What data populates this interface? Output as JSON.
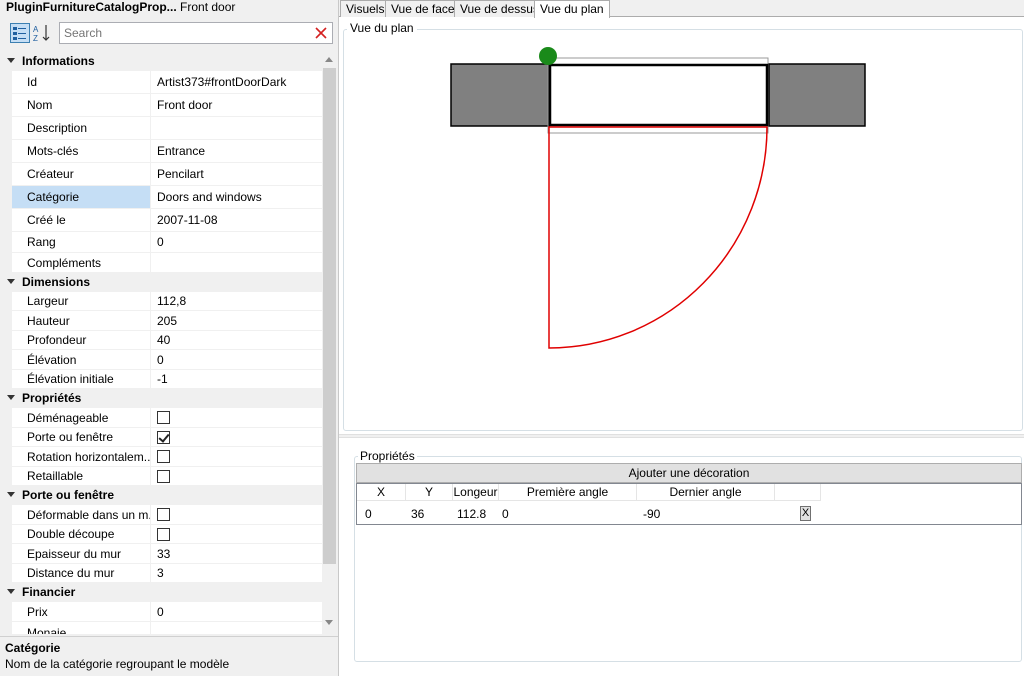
{
  "window": {
    "title_bold": "PluginFurnitureCatalogProp...",
    "title_rest": "Front door"
  },
  "toolbar": {
    "search_placeholder": "Search"
  },
  "categories": {
    "informations": "Informations",
    "dimensions": "Dimensions",
    "proprietes": "Propriétés",
    "porte": "Porte ou fenêtre",
    "financier": "Financier"
  },
  "props": {
    "id": {
      "label": "Id",
      "value": "Artist373#frontDoorDark"
    },
    "nom": {
      "label": "Nom",
      "value": "Front door"
    },
    "description": {
      "label": "Description",
      "value": ""
    },
    "mots_cles": {
      "label": "Mots-clés",
      "value": "Entrance"
    },
    "createur": {
      "label": "Créateur",
      "value": "Pencilart"
    },
    "categorie": {
      "label": "Catégorie",
      "value": "Doors and windows"
    },
    "cree_le": {
      "label": "Créé le",
      "value": "2007-11-08"
    },
    "rang": {
      "label": "Rang",
      "value": "0"
    },
    "complements": {
      "label": "Compléments",
      "value": ""
    },
    "largeur": {
      "label": "Largeur",
      "value": "112,8"
    },
    "hauteur": {
      "label": "Hauteur",
      "value": "205"
    },
    "profondeur": {
      "label": "Profondeur",
      "value": "40"
    },
    "elevation": {
      "label": "Élévation",
      "value": "0"
    },
    "elevation_initiale": {
      "label": "Élévation initiale",
      "value": "-1"
    },
    "demenageable": {
      "label": "Déménageable",
      "checked": false
    },
    "porte_fenetre": {
      "label": "Porte ou fenêtre",
      "checked": true
    },
    "rotation": {
      "label": "Rotation horizontalem...",
      "checked": false
    },
    "retaillable": {
      "label": "Retaillable",
      "checked": false
    },
    "deformable": {
      "label": "Déformable dans un m...",
      "checked": false
    },
    "double_decoupe": {
      "label": "Double découpe",
      "checked": false
    },
    "epaisseur": {
      "label": "Epaisseur du mur",
      "value": "33"
    },
    "distance": {
      "label": "Distance du mur",
      "value": "3"
    },
    "prix": {
      "label": "Prix",
      "value": "0"
    },
    "monaie": {
      "label": "Monaie",
      "value": ""
    }
  },
  "help": {
    "title": "Catégorie",
    "description": "Nom de la catégorie regroupant le modèle"
  },
  "tabs": [
    "Visuels",
    "Vue de face",
    "Vue de dessus",
    "Vue du plan"
  ],
  "active_tab": "Vue du plan",
  "plan": {
    "legend": "Vue du plan",
    "colors": {
      "wall": "#808080",
      "arc": "#e00000",
      "handle": "#1a8a1a"
    }
  },
  "decorations": {
    "legend": "Propriétés",
    "add_button": "Ajouter une décoration",
    "columns": [
      "X",
      "Y",
      "Longeur",
      "Première angle",
      "Dernier angle"
    ],
    "rows": [
      {
        "x": "0",
        "y": "36",
        "longeur": "112.8",
        "premiere": "0",
        "dernier": "-90",
        "delete": "X"
      }
    ]
  }
}
